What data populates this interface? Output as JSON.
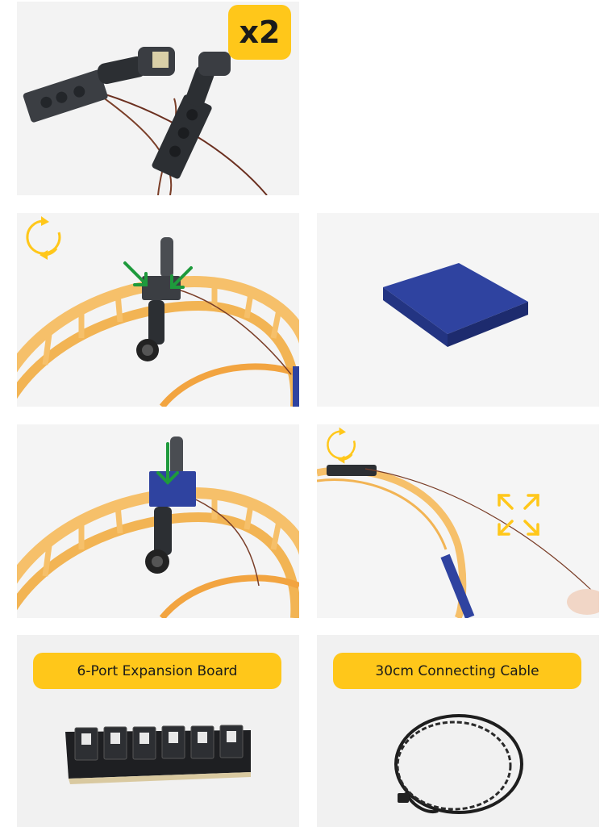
{
  "steps": {
    "step1": {
      "quantity_badge": "x2"
    },
    "part_labels": {
      "expansion_board": "6-Port Expansion Board",
      "cable": "30cm Connecting Cable"
    }
  },
  "colors": {
    "badge": "#ffc71a",
    "arrow_green": "#1e9a3c",
    "rotate_icon": "#ffc71a",
    "track": "#f6c06a",
    "tile": "#2f43a0"
  },
  "icons": [
    "rotate-icon",
    "insert-arrow-icon",
    "expand-arrows-icon"
  ]
}
